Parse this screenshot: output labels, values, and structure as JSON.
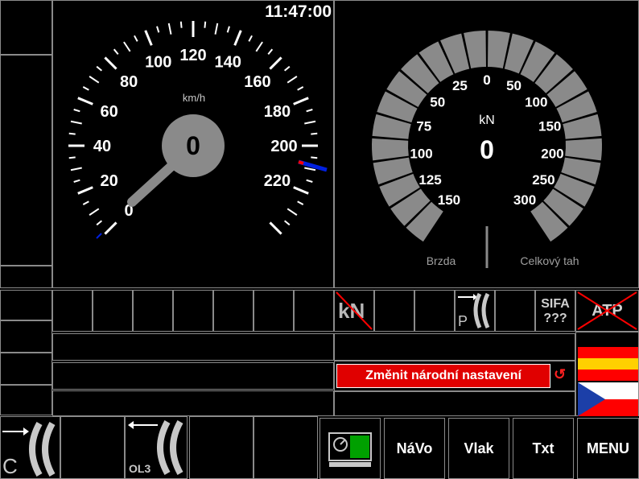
{
  "clock": "11:47:00",
  "speedometer": {
    "unit": "km/h",
    "current_speed": "0",
    "max": 240,
    "tick_labels": [
      "0",
      "20",
      "40",
      "60",
      "80",
      "100",
      "120",
      "140",
      "160",
      "180",
      "200",
      "220"
    ],
    "speed_limit_marker": 200
  },
  "traction_gauge": {
    "unit": "kN",
    "current_value": "0",
    "brake_labels": [
      "0",
      "25",
      "50",
      "75",
      "100",
      "125",
      "150"
    ],
    "traction_labels": [
      "0",
      "50",
      "100",
      "150",
      "200",
      "250",
      "300"
    ],
    "brake_caption": "Brzda",
    "traction_caption": "Celkový tah"
  },
  "status_row": {
    "kn_icon_label": "kN",
    "p_label": "P",
    "sifa_label": "SIFA",
    "sifa_value": "???",
    "atp_label": "ATP"
  },
  "message": {
    "text": "Změnit národní nastavení",
    "color": "#e00000"
  },
  "flags": {
    "top": [
      "#ff0000",
      "#ffd000",
      "#ff0000"
    ],
    "czech": [
      "#ffffff",
      "#ff0000",
      "#1c3fa8"
    ]
  },
  "bottom_bar": {
    "c_label": "C",
    "ol3_label": "OL3",
    "navo_label": "NáVo",
    "vlak_label": "Vlak",
    "txt_label": "Txt",
    "menu_label": "MENU"
  }
}
